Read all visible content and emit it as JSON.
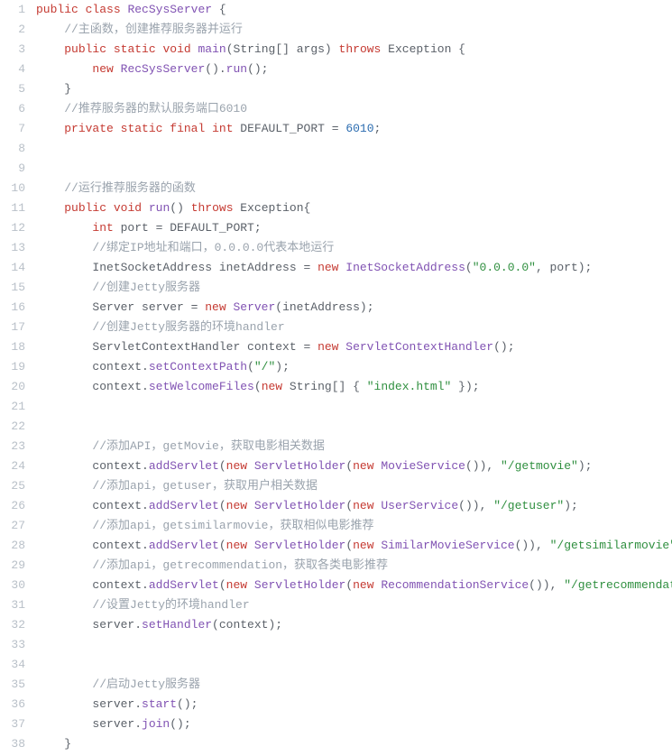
{
  "lines": [
    {
      "n": 1,
      "segs": [
        [
          "kw",
          "public"
        ],
        [
          "punct",
          " "
        ],
        [
          "kw",
          "class"
        ],
        [
          "punct",
          " "
        ],
        [
          "fn",
          "RecSysServer"
        ],
        [
          "punct",
          " {"
        ]
      ]
    },
    {
      "n": 2,
      "indent": 4,
      "segs": [
        [
          "cm",
          "//主函数，创建推荐服务器并运行"
        ]
      ]
    },
    {
      "n": 3,
      "indent": 4,
      "segs": [
        [
          "kw",
          "public"
        ],
        [
          "punct",
          " "
        ],
        [
          "kw",
          "static"
        ],
        [
          "punct",
          " "
        ],
        [
          "kw",
          "void"
        ],
        [
          "punct",
          " "
        ],
        [
          "fn",
          "main"
        ],
        [
          "punct",
          "(String[] args) "
        ],
        [
          "kw",
          "throws"
        ],
        [
          "punct",
          " Exception {"
        ]
      ]
    },
    {
      "n": 4,
      "indent": 8,
      "segs": [
        [
          "kw",
          "new"
        ],
        [
          "punct",
          " "
        ],
        [
          "fn",
          "RecSysServer"
        ],
        [
          "punct",
          "()."
        ],
        [
          "fn",
          "run"
        ],
        [
          "punct",
          "();"
        ]
      ]
    },
    {
      "n": 5,
      "indent": 4,
      "segs": [
        [
          "punct",
          "}"
        ]
      ]
    },
    {
      "n": 6,
      "indent": 4,
      "segs": [
        [
          "cm",
          "//推荐服务器的默认服务端口6010"
        ]
      ]
    },
    {
      "n": 7,
      "indent": 4,
      "segs": [
        [
          "kw",
          "private"
        ],
        [
          "punct",
          " "
        ],
        [
          "kw",
          "static"
        ],
        [
          "punct",
          " "
        ],
        [
          "kw",
          "final"
        ],
        [
          "punct",
          " "
        ],
        [
          "kw",
          "int"
        ],
        [
          "punct",
          " DEFAULT_PORT = "
        ],
        [
          "num",
          "6010"
        ],
        [
          "punct",
          ";"
        ]
      ]
    },
    {
      "n": 8,
      "segs": []
    },
    {
      "n": 9,
      "segs": []
    },
    {
      "n": 10,
      "indent": 4,
      "segs": [
        [
          "cm",
          "//运行推荐服务器的函数"
        ]
      ]
    },
    {
      "n": 11,
      "indent": 4,
      "segs": [
        [
          "kw",
          "public"
        ],
        [
          "punct",
          " "
        ],
        [
          "kw",
          "void"
        ],
        [
          "punct",
          " "
        ],
        [
          "fn",
          "run"
        ],
        [
          "punct",
          "() "
        ],
        [
          "kw",
          "throws"
        ],
        [
          "punct",
          " Exception{"
        ]
      ]
    },
    {
      "n": 12,
      "indent": 8,
      "segs": [
        [
          "kw",
          "int"
        ],
        [
          "punct",
          " port = DEFAULT_PORT;"
        ]
      ]
    },
    {
      "n": 13,
      "indent": 8,
      "segs": [
        [
          "cm",
          "//绑定IP地址和端口，0.0.0.0代表本地运行"
        ]
      ]
    },
    {
      "n": 14,
      "indent": 8,
      "segs": [
        [
          "punct",
          "InetSocketAddress inetAddress = "
        ],
        [
          "kw",
          "new"
        ],
        [
          "punct",
          " "
        ],
        [
          "fn",
          "InetSocketAddress"
        ],
        [
          "punct",
          "("
        ],
        [
          "str",
          "\"0.0.0.0\""
        ],
        [
          "punct",
          ", port);"
        ]
      ]
    },
    {
      "n": 15,
      "indent": 8,
      "segs": [
        [
          "cm",
          "//创建Jetty服务器"
        ]
      ]
    },
    {
      "n": 16,
      "indent": 8,
      "segs": [
        [
          "punct",
          "Server server = "
        ],
        [
          "kw",
          "new"
        ],
        [
          "punct",
          " "
        ],
        [
          "fn",
          "Server"
        ],
        [
          "punct",
          "(inetAddress);"
        ]
      ]
    },
    {
      "n": 17,
      "indent": 8,
      "segs": [
        [
          "cm",
          "//创建Jetty服务器的环境handler"
        ]
      ]
    },
    {
      "n": 18,
      "indent": 8,
      "segs": [
        [
          "punct",
          "ServletContextHandler context = "
        ],
        [
          "kw",
          "new"
        ],
        [
          "punct",
          " "
        ],
        [
          "fn",
          "ServletContextHandler"
        ],
        [
          "punct",
          "();"
        ]
      ]
    },
    {
      "n": 19,
      "indent": 8,
      "segs": [
        [
          "punct",
          "context."
        ],
        [
          "fn",
          "setContextPath"
        ],
        [
          "punct",
          "("
        ],
        [
          "str",
          "\"/\""
        ],
        [
          "punct",
          ");"
        ]
      ]
    },
    {
      "n": 20,
      "indent": 8,
      "segs": [
        [
          "punct",
          "context."
        ],
        [
          "fn",
          "setWelcomeFiles"
        ],
        [
          "punct",
          "("
        ],
        [
          "kw",
          "new"
        ],
        [
          "punct",
          " String[] { "
        ],
        [
          "str",
          "\"index.html\""
        ],
        [
          "punct",
          " });"
        ]
      ]
    },
    {
      "n": 21,
      "segs": []
    },
    {
      "n": 22,
      "segs": []
    },
    {
      "n": 23,
      "indent": 8,
      "segs": [
        [
          "cm",
          "//添加API，getMovie，获取电影相关数据"
        ]
      ]
    },
    {
      "n": 24,
      "indent": 8,
      "segs": [
        [
          "punct",
          "context."
        ],
        [
          "fn",
          "addServlet"
        ],
        [
          "punct",
          "("
        ],
        [
          "kw",
          "new"
        ],
        [
          "punct",
          " "
        ],
        [
          "fn",
          "ServletHolder"
        ],
        [
          "punct",
          "("
        ],
        [
          "kw",
          "new"
        ],
        [
          "punct",
          " "
        ],
        [
          "fn",
          "MovieService"
        ],
        [
          "punct",
          "()), "
        ],
        [
          "str",
          "\"/getmovie\""
        ],
        [
          "punct",
          ");"
        ]
      ]
    },
    {
      "n": 25,
      "indent": 8,
      "segs": [
        [
          "cm",
          "//添加api，getuser，获取用户相关数据"
        ]
      ]
    },
    {
      "n": 26,
      "indent": 8,
      "segs": [
        [
          "punct",
          "context."
        ],
        [
          "fn",
          "addServlet"
        ],
        [
          "punct",
          "("
        ],
        [
          "kw",
          "new"
        ],
        [
          "punct",
          " "
        ],
        [
          "fn",
          "ServletHolder"
        ],
        [
          "punct",
          "("
        ],
        [
          "kw",
          "new"
        ],
        [
          "punct",
          " "
        ],
        [
          "fn",
          "UserService"
        ],
        [
          "punct",
          "()), "
        ],
        [
          "str",
          "\"/getuser\""
        ],
        [
          "punct",
          ");"
        ]
      ]
    },
    {
      "n": 27,
      "indent": 8,
      "segs": [
        [
          "cm",
          "//添加api，getsimilarmovie，获取相似电影推荐"
        ]
      ]
    },
    {
      "n": 28,
      "indent": 8,
      "segs": [
        [
          "punct",
          "context."
        ],
        [
          "fn",
          "addServlet"
        ],
        [
          "punct",
          "("
        ],
        [
          "kw",
          "new"
        ],
        [
          "punct",
          " "
        ],
        [
          "fn",
          "ServletHolder"
        ],
        [
          "punct",
          "("
        ],
        [
          "kw",
          "new"
        ],
        [
          "punct",
          " "
        ],
        [
          "fn",
          "SimilarMovieService"
        ],
        [
          "punct",
          "()), "
        ],
        [
          "str",
          "\"/getsimilarmovie\""
        ],
        [
          "punct",
          ");"
        ]
      ]
    },
    {
      "n": 29,
      "indent": 8,
      "segs": [
        [
          "cm",
          "//添加api，getrecommendation，获取各类电影推荐"
        ]
      ]
    },
    {
      "n": 30,
      "indent": 8,
      "segs": [
        [
          "punct",
          "context."
        ],
        [
          "fn",
          "addServlet"
        ],
        [
          "punct",
          "("
        ],
        [
          "kw",
          "new"
        ],
        [
          "punct",
          " "
        ],
        [
          "fn",
          "ServletHolder"
        ],
        [
          "punct",
          "("
        ],
        [
          "kw",
          "new"
        ],
        [
          "punct",
          " "
        ],
        [
          "fn",
          "RecommendationService"
        ],
        [
          "punct",
          "()), "
        ],
        [
          "str",
          "\"/getrecommendation\""
        ],
        [
          "punct",
          ");"
        ]
      ]
    },
    {
      "n": 31,
      "indent": 8,
      "segs": [
        [
          "cm",
          "//设置Jetty的环境handler"
        ]
      ]
    },
    {
      "n": 32,
      "indent": 8,
      "segs": [
        [
          "punct",
          "server."
        ],
        [
          "fn",
          "setHandler"
        ],
        [
          "punct",
          "(context);"
        ]
      ]
    },
    {
      "n": 33,
      "segs": []
    },
    {
      "n": 34,
      "segs": []
    },
    {
      "n": 35,
      "indent": 8,
      "segs": [
        [
          "cm",
          "//启动Jetty服务器"
        ]
      ]
    },
    {
      "n": 36,
      "indent": 8,
      "segs": [
        [
          "punct",
          "server."
        ],
        [
          "fn",
          "start"
        ],
        [
          "punct",
          "();"
        ]
      ]
    },
    {
      "n": 37,
      "indent": 8,
      "segs": [
        [
          "punct",
          "server."
        ],
        [
          "fn",
          "join"
        ],
        [
          "punct",
          "();"
        ]
      ]
    },
    {
      "n": 38,
      "indent": 4,
      "segs": [
        [
          "punct",
          "}"
        ]
      ]
    }
  ]
}
